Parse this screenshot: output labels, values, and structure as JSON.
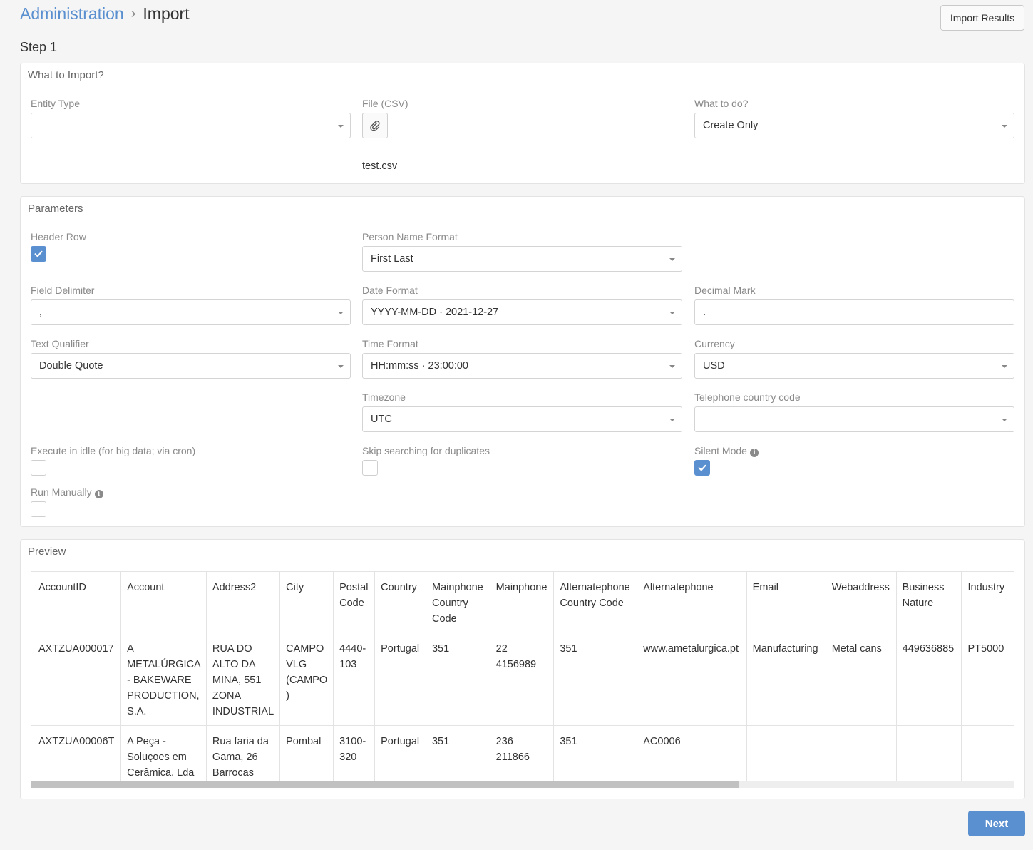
{
  "breadcrumb": {
    "parent": "Administration",
    "separator": "›",
    "current": "Import"
  },
  "import_results_label": "Import Results",
  "step_label": "Step 1",
  "what_to_import": {
    "title": "What to Import?",
    "entity_type": {
      "label": "Entity Type",
      "value": ""
    },
    "file": {
      "label": "File (CSV)",
      "filename": "test.csv"
    },
    "what_to_do": {
      "label": "What to do?",
      "value": "Create Only"
    }
  },
  "parameters": {
    "title": "Parameters",
    "header_row": {
      "label": "Header Row",
      "checked": true
    },
    "person_name_format": {
      "label": "Person Name Format",
      "value": "First Last"
    },
    "field_delimiter": {
      "label": "Field Delimiter",
      "value": ","
    },
    "date_format": {
      "label": "Date Format",
      "value": "YYYY-MM-DD · 2021-12-27"
    },
    "decimal_mark": {
      "label": "Decimal Mark",
      "value": "."
    },
    "text_qualifier": {
      "label": "Text Qualifier",
      "value": "Double Quote"
    },
    "time_format": {
      "label": "Time Format",
      "value": "HH:mm:ss · 23:00:00"
    },
    "currency": {
      "label": "Currency",
      "value": "USD"
    },
    "timezone": {
      "label": "Timezone",
      "value": "UTC"
    },
    "telephone_country_code": {
      "label": "Telephone country code",
      "value": ""
    },
    "execute_in_idle": {
      "label": "Execute in idle (for big data; via cron)",
      "checked": false
    },
    "skip_duplicates": {
      "label": "Skip searching for duplicates",
      "checked": false
    },
    "silent_mode": {
      "label": "Silent Mode",
      "checked": true
    },
    "run_manually": {
      "label": "Run Manually",
      "checked": false
    }
  },
  "preview": {
    "title": "Preview",
    "columns": [
      "AccountID",
      "Account",
      "Address2",
      "City",
      "Postal Code",
      "Country",
      "Mainphone Country Code",
      "Mainphone",
      "Alternatephone Country Code",
      "Alternatephone",
      "Email",
      "Webaddress",
      "Business Nature",
      "Industry"
    ],
    "rows": [
      [
        "AXTZUA000017",
        "A METALÚRGICA - BAKEWARE PRODUCTION, S.A.",
        "RUA DO ALTO DA MINA, 551 ZONA INDUSTRIAL",
        "CAMPO VLG (CAMPO )",
        "4440-103",
        "Portugal",
        "351",
        "22 4156989",
        "351",
        "www.ametalurgica.pt",
        "Manufacturing",
        "Metal cans",
        "449636885",
        "PT5000"
      ],
      [
        "AXTZUA00006T",
        "A Peça - Soluçoes em Cerâmica, Lda",
        "Rua faria da Gama, 26 Barrocas",
        "Pombal",
        "3100-320",
        "Portugal",
        "351",
        "236 211866",
        "351",
        "AC0006",
        "",
        "",
        "",
        ""
      ]
    ],
    "scroll_fraction": 0.72
  },
  "next_label": "Next",
  "colors": {
    "accent": "#5a8fd0",
    "background": "#f5f5f5",
    "panel": "#ffffff"
  }
}
